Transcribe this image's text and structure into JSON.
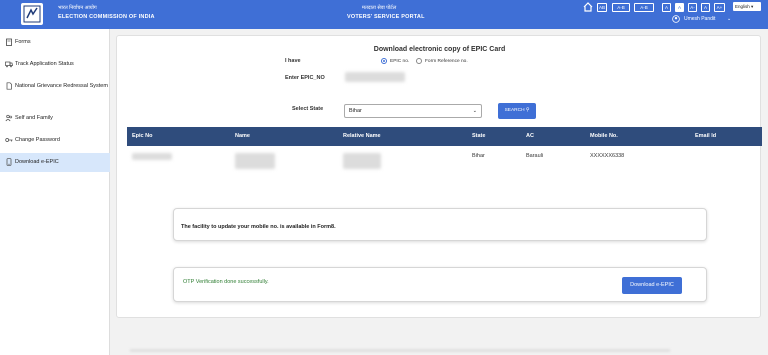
{
  "header": {
    "org_hindi": "भारत निर्वाचन आयोग",
    "org_english": "ELECTION COMMISSION OF INDIA",
    "portal_hindi": "मतदाता सेवा पोर्टल",
    "portal_english": "VOTERS' SERVICE PORTAL",
    "text_controls": [
      "AB",
      "A-B",
      "A-B",
      "A",
      "A",
      "A-",
      "A",
      "A+"
    ],
    "language": "English",
    "user_name": "Umesh Pandit"
  },
  "sidebar": {
    "items": [
      {
        "label": "Forms",
        "icon": "clipboard-icon"
      },
      {
        "label": "Track Application Status",
        "icon": "truck-icon"
      },
      {
        "label": "National Grievance Redressal System",
        "icon": "document-icon"
      },
      {
        "label": "Self and Family",
        "icon": "people-icon"
      },
      {
        "label": "Change Password",
        "icon": "key-icon"
      },
      {
        "label": "Download e-EPIC",
        "icon": "phone-card-icon"
      }
    ]
  },
  "main": {
    "title": "Download electronic copy of EPIC Card",
    "i_have_label": "I have",
    "radio_epic": "EPIC no.",
    "radio_form_ref": "Form Reference no.",
    "enter_epic_label": "Enter EPIC_NO",
    "select_state_label": "Select State",
    "selected_state": "Bihar",
    "search_label": "SEARCH",
    "table": {
      "headers": [
        "Epic No",
        "Name",
        "Relative Name",
        "State",
        "AC",
        "Mobile No.",
        "Email Id"
      ],
      "row": {
        "state": "Bihar",
        "ac": "Barauli",
        "mobile": "XXXXXX6338"
      }
    },
    "mobile_update_notice": "The facility to update your mobile no. is available in Form8.",
    "otp_message": "OTP Verification done successfully.",
    "download_label": "Download e-EPIC"
  }
}
